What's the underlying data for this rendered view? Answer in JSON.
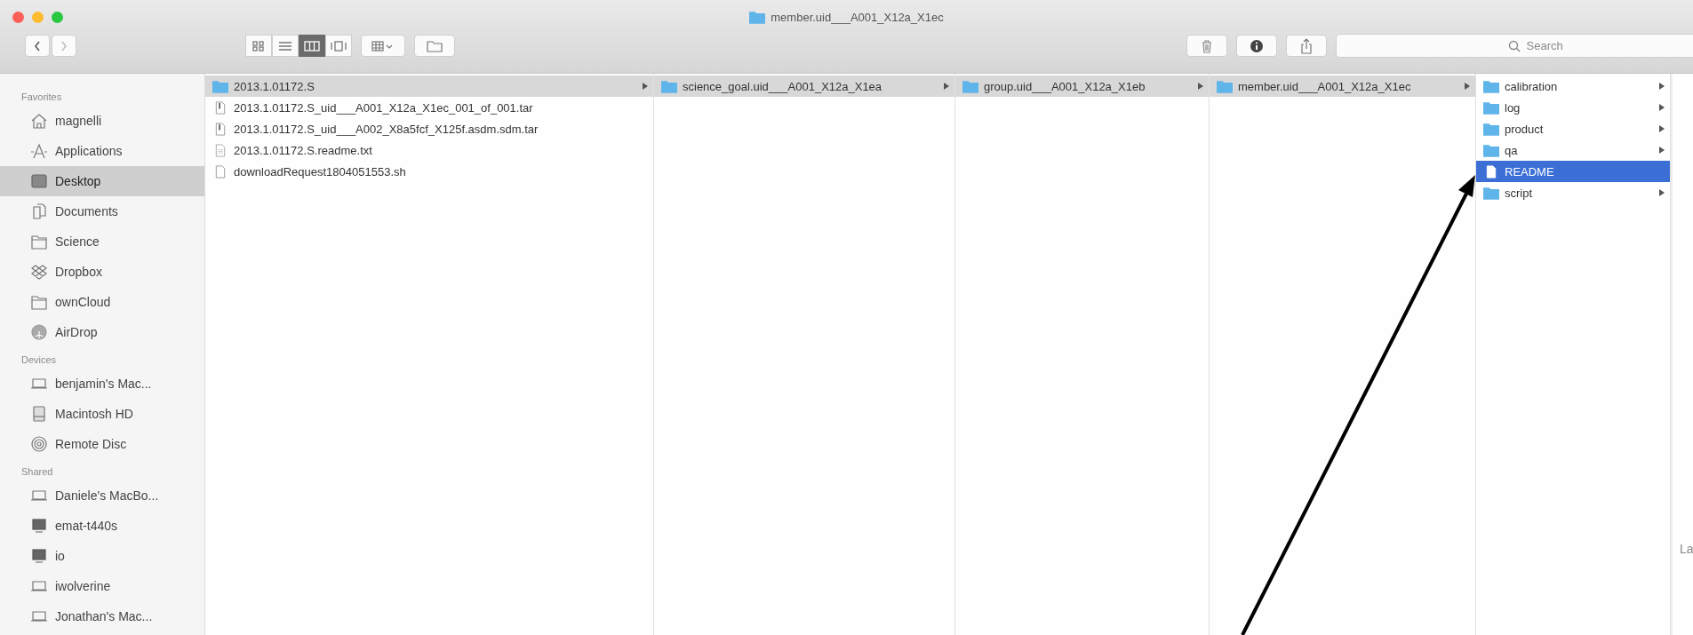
{
  "window": {
    "title": "member.uid___A001_X12a_X1ec"
  },
  "toolbar": {
    "view_buttons": [
      {
        "kind": "icons",
        "selected": false
      },
      {
        "kind": "list",
        "selected": false
      },
      {
        "kind": "columns",
        "selected": true
      },
      {
        "kind": "coverflow",
        "selected": false
      }
    ],
    "search": {
      "placeholder": "Search"
    }
  },
  "sidebar": {
    "sections": [
      {
        "title": "Favorites",
        "items": [
          {
            "label": "magnelli",
            "kind": "home",
            "selected": false
          },
          {
            "label": "Applications",
            "kind": "apps",
            "selected": false
          },
          {
            "label": "Desktop",
            "kind": "desktop",
            "selected": true
          },
          {
            "label": "Documents",
            "kind": "documents",
            "selected": false
          },
          {
            "label": "Science",
            "kind": "folder",
            "selected": false
          },
          {
            "label": "Dropbox",
            "kind": "dropbox",
            "selected": false
          },
          {
            "label": "ownCloud",
            "kind": "folder",
            "selected": false
          },
          {
            "label": "AirDrop",
            "kind": "airdrop",
            "selected": false
          }
        ]
      },
      {
        "title": "Devices",
        "items": [
          {
            "label": "benjamin's Mac...",
            "kind": "laptop",
            "selected": false
          },
          {
            "label": "Macintosh HD",
            "kind": "disk",
            "selected": false
          },
          {
            "label": "Remote Disc",
            "kind": "disc",
            "selected": false
          }
        ]
      },
      {
        "title": "Shared",
        "items": [
          {
            "label": "Daniele's MacBo...",
            "kind": "laptop",
            "selected": false
          },
          {
            "label": "emat-t440s",
            "kind": "monitor",
            "selected": false
          },
          {
            "label": "io",
            "kind": "monitor",
            "selected": false
          },
          {
            "label": "iwolverine",
            "kind": "laptop",
            "selected": false
          },
          {
            "label": "Jonathan's Mac...",
            "kind": "laptop",
            "selected": false
          }
        ]
      }
    ]
  },
  "columns": [
    {
      "focused": false,
      "items": [
        {
          "name": "2013.1.01172.S",
          "kind": "folder",
          "selected": true
        },
        {
          "name": "2013.1.01172.S_uid___A001_X12a_X1ec_001_of_001.tar",
          "kind": "archive",
          "selected": false
        },
        {
          "name": "2013.1.01172.S_uid___A002_X8a5fcf_X125f.asdm.sdm.tar",
          "kind": "archive",
          "selected": false
        },
        {
          "name": "2013.1.01172.S.readme.txt",
          "kind": "text",
          "selected": false
        },
        {
          "name": "downloadRequest1804051553.sh",
          "kind": "file",
          "selected": false
        }
      ]
    },
    {
      "focused": false,
      "items": [
        {
          "name": "science_goal.uid___A001_X12a_X1ea",
          "kind": "folder",
          "selected": true
        }
      ]
    },
    {
      "focused": false,
      "items": [
        {
          "name": "group.uid___A001_X12a_X1eb",
          "kind": "folder",
          "selected": true
        }
      ]
    },
    {
      "focused": false,
      "items": [
        {
          "name": "member.uid___A001_X12a_X1ec",
          "kind": "folder",
          "selected": true
        }
      ]
    },
    {
      "focused": true,
      "items": [
        {
          "name": "calibration",
          "kind": "folder",
          "selected": false
        },
        {
          "name": "log",
          "kind": "folder",
          "selected": false
        },
        {
          "name": "product",
          "kind": "folder",
          "selected": false
        },
        {
          "name": "qa",
          "kind": "folder",
          "selected": false
        },
        {
          "name": "README",
          "kind": "file",
          "selected": true
        },
        {
          "name": "script",
          "kind": "folder",
          "selected": false
        }
      ]
    }
  ],
  "preview": {
    "text": "La"
  }
}
